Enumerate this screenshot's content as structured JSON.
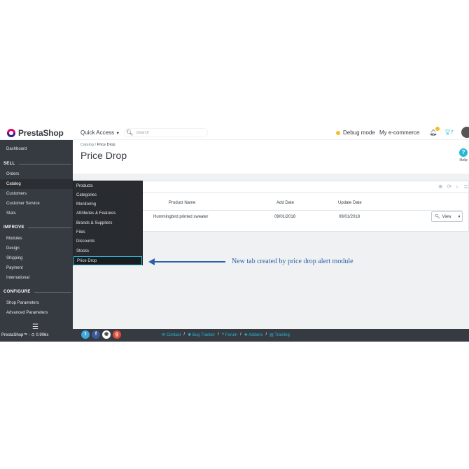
{
  "header": {
    "logo_text": "PrestaShop",
    "quick_access": "Quick Access",
    "search_placeholder": "Search",
    "debug_mode": "Debug mode",
    "shop_name": "My e-commerce",
    "notification_count": "7"
  },
  "sidebar": {
    "dashboard": "Dashboard",
    "section_sell": "SELL",
    "orders": "Orders",
    "catalog": "Catalog",
    "customers": "Customers",
    "customer_service": "Customer Service",
    "stats": "Stats",
    "section_improve": "IMPROVE",
    "modules": "Modules",
    "design": "Design",
    "shipping": "Shipping",
    "payment": "Payment",
    "international": "International",
    "section_configure": "CONFIGURE",
    "shop_parameters": "Shop Parameters",
    "advanced_parameters": "Advanced Parameters"
  },
  "submenu": {
    "items": [
      "Products",
      "Categories",
      "Monitoring",
      "Attributes & Features",
      "Brands & Suppliers",
      "Files",
      "Discounts",
      "Stocks",
      "Price Drop"
    ]
  },
  "breadcrumb": {
    "parent": "Catalog",
    "separator": "/",
    "current": "Price Drop"
  },
  "page": {
    "title": "Price Drop",
    "help_label": "Help"
  },
  "table": {
    "columns": {
      "product_name": "Product Name",
      "add_date": "Add Date",
      "update_date": "Update Date"
    },
    "row": {
      "product_name": "Hummingbird printed sweater",
      "add_date": "09/01/2018",
      "update_date": "09/01/2018",
      "action": "View"
    }
  },
  "annotation": {
    "text": "New tab created by price drop alert module"
  },
  "footer": {
    "brand": "PrestaShop™ - ⊙ 0.906s",
    "links": [
      "Contact",
      "Bug Tracker",
      "Forum",
      "Addons",
      "Training"
    ],
    "link_separator": "/"
  },
  "colors": {
    "sidebar_bg": "#363a41",
    "accent": "#25b9d7",
    "brand_pink": "#df0067",
    "annotation_blue": "#2b5ea8"
  }
}
